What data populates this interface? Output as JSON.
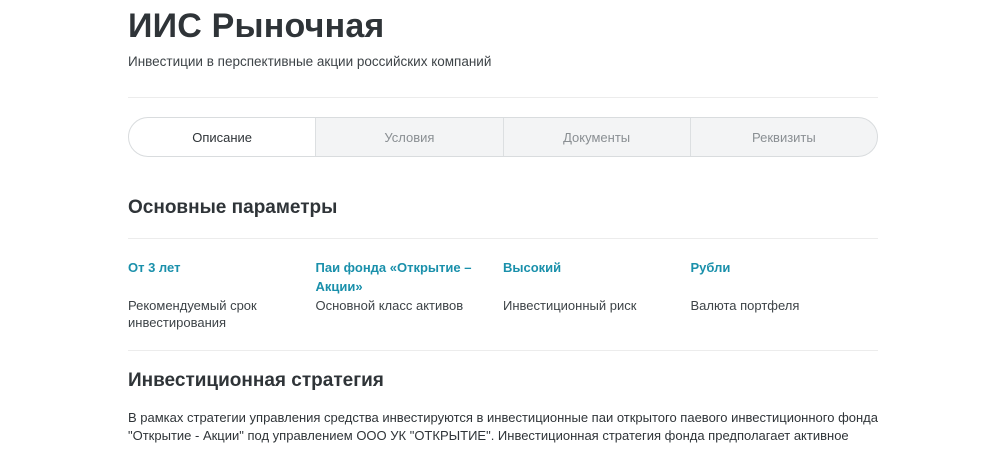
{
  "header": {
    "title": "ИИС Рыночная",
    "subtitle": "Инвестиции в перспективные акции российских компаний"
  },
  "tabs": [
    {
      "label": "Описание",
      "active": true
    },
    {
      "label": "Условия",
      "active": false
    },
    {
      "label": "Документы",
      "active": false
    },
    {
      "label": "Реквизиты",
      "active": false
    }
  ],
  "main_params": {
    "heading": "Основные параметры",
    "items": [
      {
        "value": "От 3 лет",
        "label": "Рекомендуемый срок инвестирования"
      },
      {
        "value": "Паи фонда «Открытие – Акции»",
        "label": "Основной класс активов"
      },
      {
        "value": "Высокий",
        "label": "Инвестиционный риск"
      },
      {
        "value": "Рубли",
        "label": "Валюта портфеля"
      }
    ]
  },
  "strategy": {
    "heading": "Инвестиционная стратегия",
    "text": "В рамках стратегии управления средства инвестируются в инвестиционные паи открытого паевого инвестиционного фонда \"Открытие - Акции\" под управлением ООО УК \"ОТКРЫТИЕ\". Инвестиционная стратегия фонда предполагает активное"
  },
  "colors": {
    "accent": "#1a90ab",
    "text": "#2f3438",
    "tab_bg": "#f3f4f5"
  }
}
